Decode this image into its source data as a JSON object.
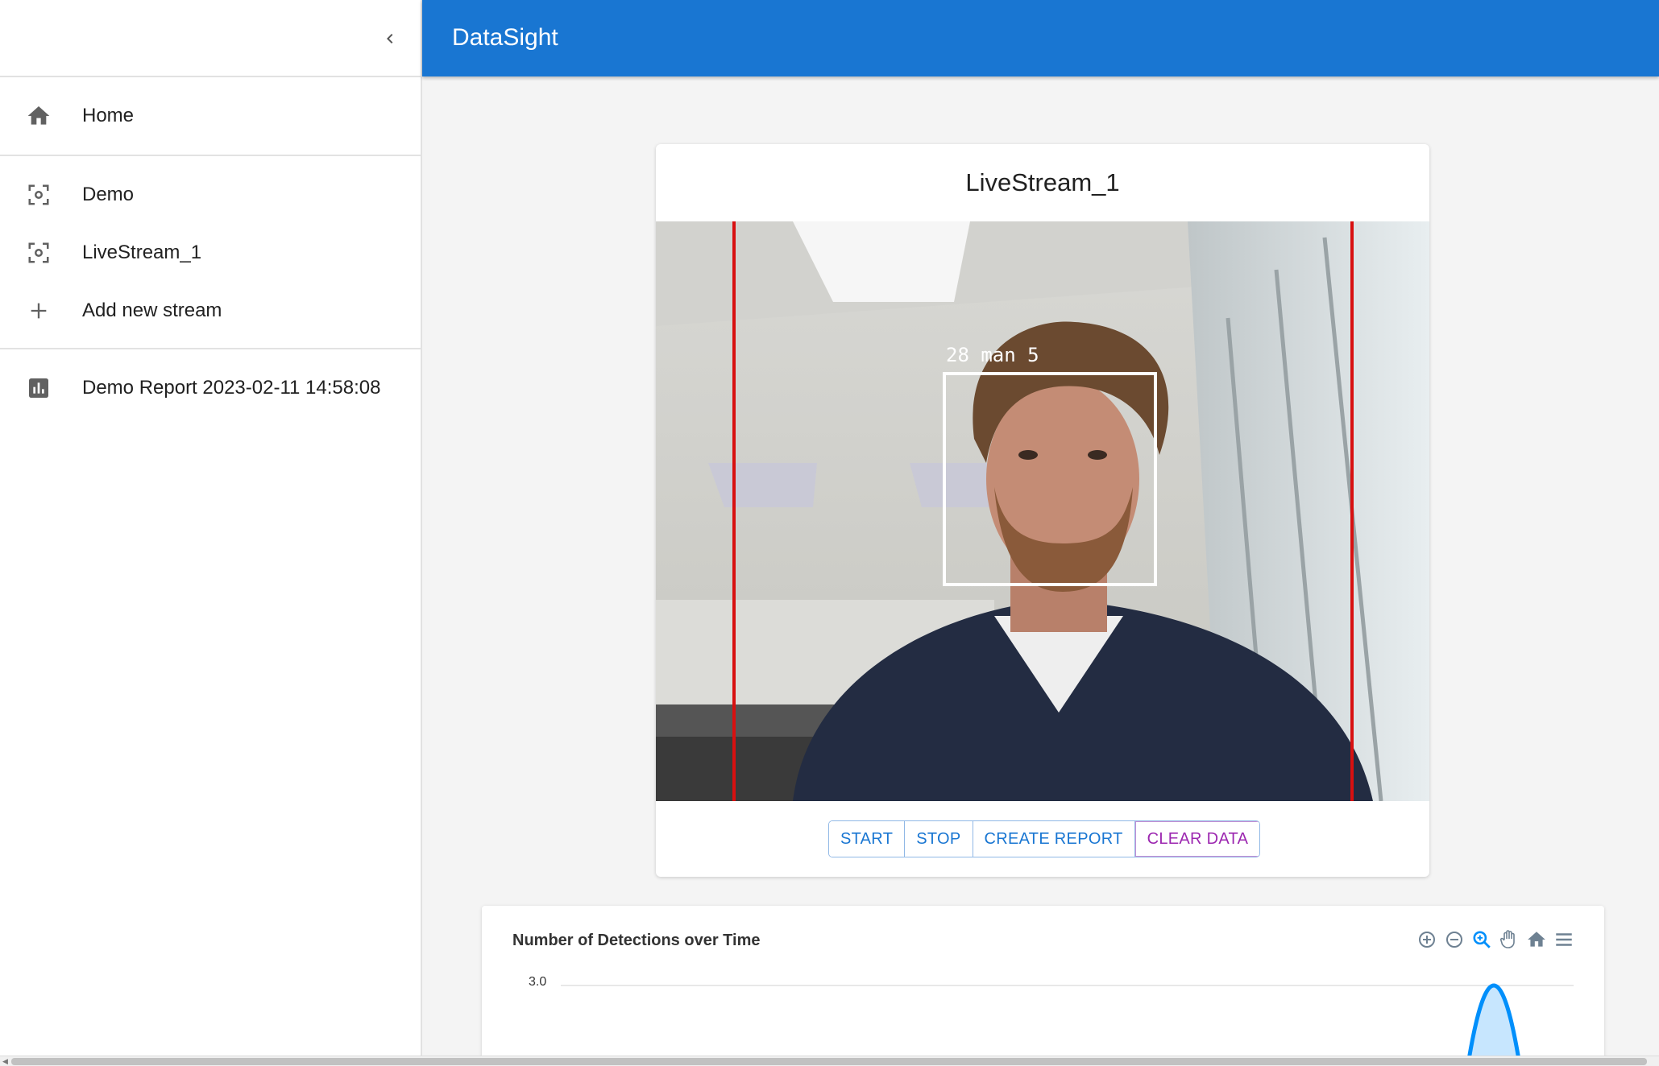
{
  "app": {
    "title": "DataSight"
  },
  "sidebar": {
    "items": [
      {
        "label": "Home",
        "icon": "home-icon"
      },
      {
        "label": "Demo",
        "icon": "camera-focus-icon"
      },
      {
        "label": "LiveStream_1",
        "icon": "camera-focus-icon"
      },
      {
        "label": "Add new stream",
        "icon": "plus-icon"
      },
      {
        "label": "Demo Report 2023-02-11 14:58:08",
        "icon": "bar-chart-icon"
      }
    ]
  },
  "stream": {
    "title": "LiveStream_1",
    "detection_label": "28 man 5",
    "buttons": {
      "start": "START",
      "stop": "STOP",
      "create_report": "CREATE REPORT",
      "clear_data": "CLEAR DATA"
    }
  },
  "chart": {
    "title": "Number of Detections over Time",
    "toolbar": [
      "zoom-in-icon",
      "zoom-out-icon",
      "selection-zoom-icon",
      "pan-icon",
      "reset-home-icon",
      "menu-icon"
    ]
  },
  "chart_data": {
    "type": "area",
    "title": "Number of Detections over Time",
    "y_ticks": [
      "3.0"
    ],
    "ylim": [
      0,
      3.0
    ],
    "series": [
      {
        "values": [
          0,
          3.0,
          0
        ]
      }
    ]
  },
  "colors": {
    "primary": "#1976d2",
    "secondary": "#9c27b0",
    "boundary_line": "#d81010"
  }
}
